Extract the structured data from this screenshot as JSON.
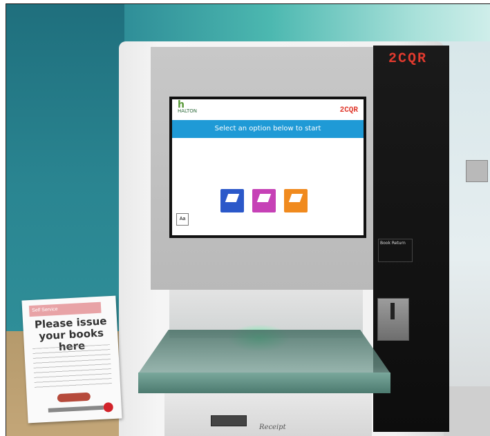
{
  "kiosk": {
    "brand": "2CQR",
    "side_label": "Book Return",
    "screen": {
      "brand": "2CQR",
      "logo_mark": "h",
      "logo_text": "HALTON",
      "banner": "Select an option below to start",
      "options": [
        {
          "icon": "book-icon",
          "color": "#2b58c9"
        },
        {
          "icon": "id-card-icon",
          "color": "#c641b6"
        },
        {
          "icon": "renew-icon",
          "color": "#f08a1e"
        }
      ],
      "accessibility_button": "Aa"
    },
    "receipt_label": "Receipt"
  },
  "sign": {
    "topbar": "Self Service",
    "heading": "Please issue your books here"
  },
  "colors": {
    "wall_teal": "#2a8591",
    "brand_red": "#e03a2e",
    "banner_blue": "#1f9ad6",
    "glow_green": "#50ffa0"
  }
}
